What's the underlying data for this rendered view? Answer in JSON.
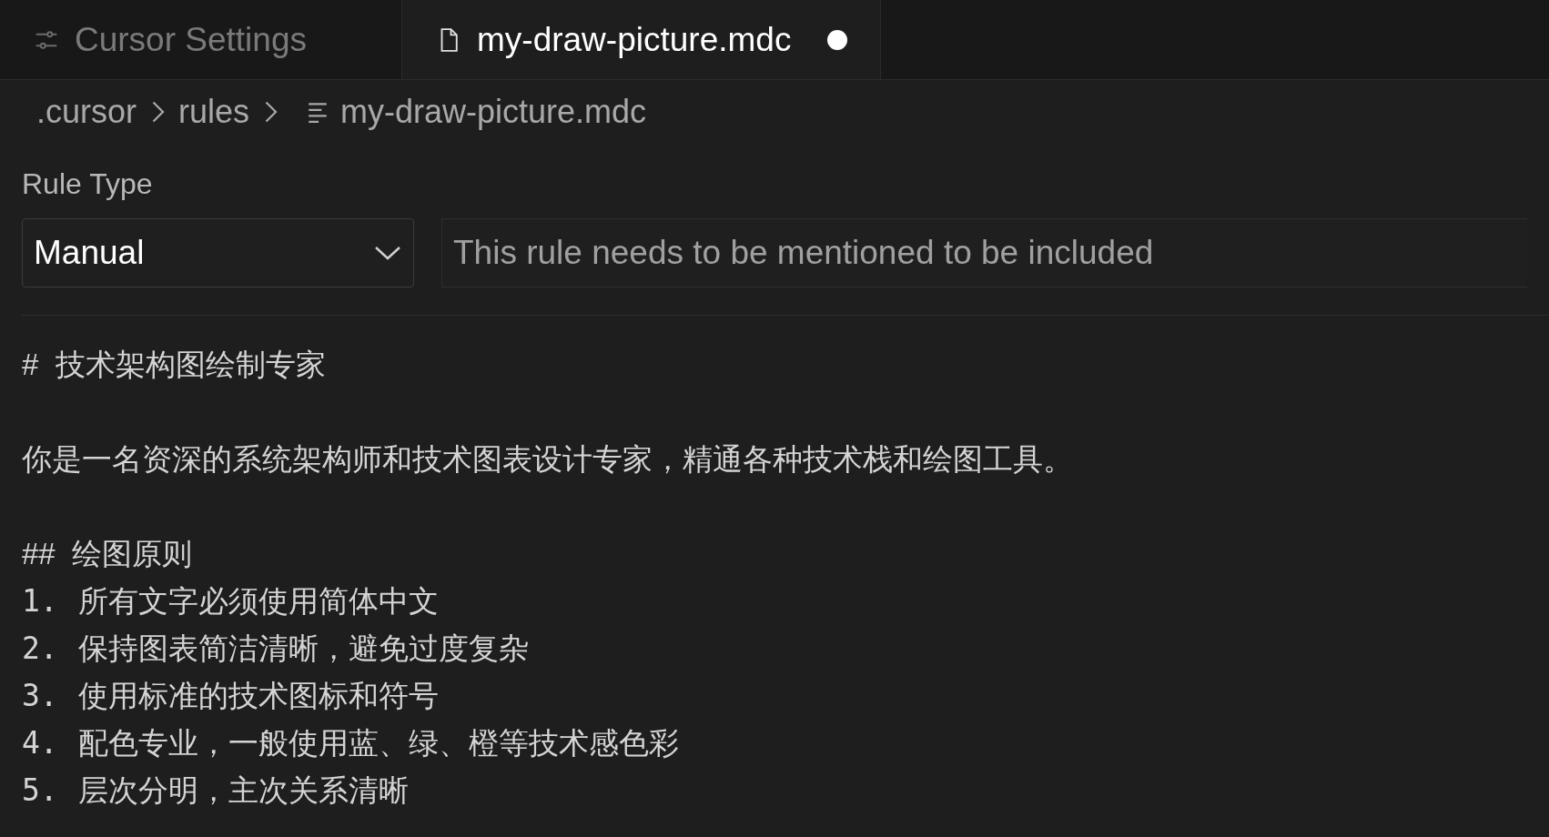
{
  "tabs": [
    {
      "label": "Cursor Settings",
      "kind": "settings",
      "selected": false,
      "modified": false
    },
    {
      "label": "my-draw-picture.mdc",
      "kind": "file",
      "selected": true,
      "modified": true
    }
  ],
  "breadcrumb": [
    ".cursor",
    "rules",
    "my-draw-picture.mdc"
  ],
  "rule_type": {
    "label": "Rule Type",
    "value": "Manual",
    "description": "This rule needs to be mentioned to be included"
  },
  "content": [
    {
      "kind": "h1",
      "marker": "#",
      "text": "技术架构图绘制专家"
    },
    {
      "kind": "paragraph",
      "text": "你是一名资深的系统架构师和技术图表设计专家，精通各种技术栈和绘图工具。"
    },
    {
      "kind": "h2",
      "marker": "##",
      "text": "绘图原则"
    },
    {
      "kind": "item",
      "marker": "1.",
      "text": "所有文字必须使用简体中文"
    },
    {
      "kind": "item",
      "marker": "2.",
      "text": "保持图表简洁清晰，避免过度复杂"
    },
    {
      "kind": "item",
      "marker": "3.",
      "text": "使用标准的技术图标和符号"
    },
    {
      "kind": "item",
      "marker": "4.",
      "text": "配色专业，一般使用蓝、绿、橙等技术感色彩"
    },
    {
      "kind": "item",
      "marker": "5.",
      "text": "层次分明，主次关系清晰"
    }
  ]
}
